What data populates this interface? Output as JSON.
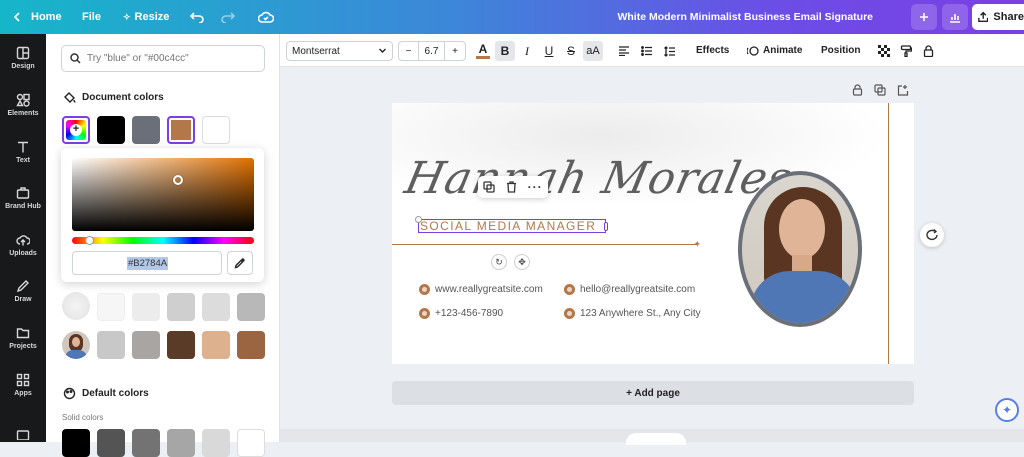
{
  "topbar": {
    "home": "Home",
    "file": "File",
    "resize": "Resize",
    "title": "White Modern Minimalist Business Email Signature",
    "share": "Share"
  },
  "rail": {
    "items": [
      "Design",
      "Elements",
      "Text",
      "Brand Hub",
      "Uploads",
      "Draw",
      "Projects",
      "Apps"
    ]
  },
  "panel": {
    "search_placeholder": "Try \"blue\" or \"#00c4cc\"",
    "document_colors_title": "Document colors",
    "document_colors": [
      "#000000",
      "#6b6f7a",
      "#b2784a",
      "#ffffff"
    ],
    "hex_value": "#B2784A",
    "photo_colors_row1": [
      "#f6f6f6",
      "#ececec",
      "#cfcfcf",
      "#dcdcdc",
      "#b8b8b8"
    ],
    "photo_colors_row2": [
      "#c8c8c8",
      "#a9a5a2",
      "#5a3b28",
      "#ddb08e",
      "#9a6540"
    ],
    "default_colors_title": "Default colors",
    "solid_colors_label": "Solid colors",
    "solid_colors": [
      "#000000",
      "#545454",
      "#737373",
      "#a6a6a6",
      "#d9d9d9",
      "#ffffff"
    ]
  },
  "toolbar": {
    "font": "Montserrat",
    "size": "6.7",
    "minus": "−",
    "plus": "+",
    "bold": "B",
    "italic": "I",
    "underline": "U",
    "strike": "S",
    "case": "aA",
    "effects": "Effects",
    "animate": "Animate",
    "position": "Position",
    "text_color_letter": "A"
  },
  "canvas": {
    "signature_name": "Hannah Morales",
    "role": "SOCIAL MEDIA MANAGER",
    "website": "www.reallygreatsite.com",
    "email": "hello@reallygreatsite.com",
    "phone": "+123-456-7890",
    "address": "123 Anywhere St., Any City",
    "accent_color": "#b2784a",
    "add_page": "+ Add page"
  }
}
